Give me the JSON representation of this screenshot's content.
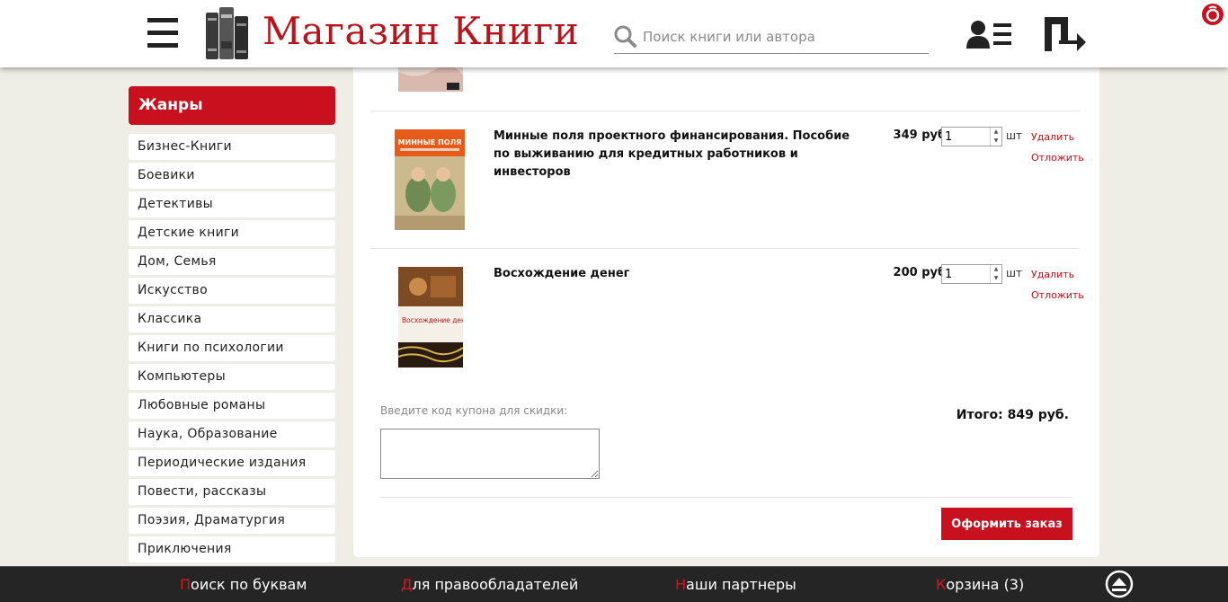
{
  "header": {
    "logo_text": "Магазин Книги",
    "search_placeholder": "Поиск книги или автора"
  },
  "sidebar": {
    "title": "Жанры",
    "genres": [
      "Бизнес-Книги",
      "Боевики",
      "Детективы",
      "Детские книги",
      "Дом, Семья",
      "Искусство",
      "Классика",
      "Книги по психологии",
      "Компьютеры",
      "Любовные романы",
      "Наука, Образование",
      "Периодические издания",
      "Повести, рассказы",
      "Поэзия, Драматургия",
      "Приключения"
    ]
  },
  "cart": {
    "items": [
      {
        "title": "Минные поля проектного финансирования. Пособие по выживанию для кредитных работников и инвесторов",
        "price": "349 руб.",
        "qty": "1",
        "unit": "шт",
        "delete": "Удалить",
        "postpone": "Отложить",
        "cover_title": "МИННЫЕ ПОЛЯ"
      },
      {
        "title": "Восхождение денег",
        "price": "200 руб.",
        "qty": "1",
        "unit": "шт",
        "delete": "Удалить",
        "postpone": "Отложить",
        "cover_title": "Восхождение денег"
      }
    ],
    "coupon_label": "Введите код купона для скидки:",
    "total": "Итого: 849 руб.",
    "order_button": "Оформить заказ"
  },
  "footer": {
    "links": [
      {
        "first": "П",
        "rest": "оиск по буквам"
      },
      {
        "first": "Д",
        "rest": "ля правообладателей"
      },
      {
        "first": "Н",
        "rest": "аши партнеры"
      },
      {
        "first": "К",
        "rest": "орзина (3)"
      }
    ]
  },
  "colors": {
    "accent": "#c8101e",
    "background": "#eeede6",
    "footer": "#252525"
  }
}
